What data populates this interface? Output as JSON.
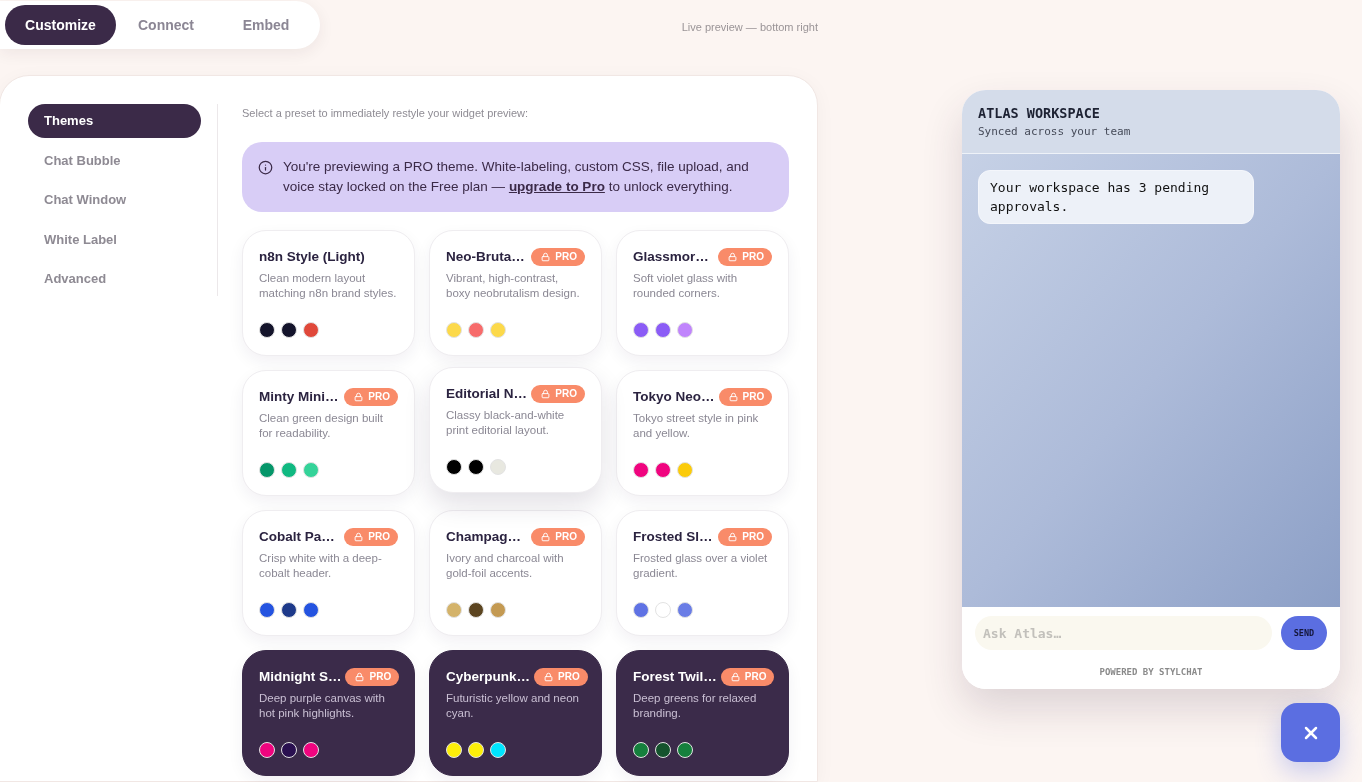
{
  "top_tabs": [
    {
      "label": "Customize",
      "selected": true
    },
    {
      "label": "Connect",
      "selected": false
    },
    {
      "label": "Embed",
      "selected": false
    }
  ],
  "preview_note": "Live preview — bottom right",
  "sidebar": {
    "items": [
      {
        "label": "Themes",
        "selected": true
      },
      {
        "label": "Chat Bubble",
        "selected": false
      },
      {
        "label": "Chat Window",
        "selected": false
      },
      {
        "label": "White Label",
        "selected": false
      },
      {
        "label": "Advanced",
        "selected": false
      }
    ]
  },
  "themes": {
    "instruction": "Select a preset to immediately restyle your widget preview:",
    "notice": {
      "text": "You're previewing a PRO theme. White-labeling, custom CSS, file upload, and voice stay locked on the Free plan — ",
      "link": "upgrade to Pro",
      "text_after": " to unlock everything."
    },
    "cards": [
      {
        "title": "n8n Style (Light)",
        "description": "Clean modern layout matching n8n brand styles.",
        "dark": false,
        "hovered": false,
        "swatches": [
          {
            "color": "#14142b"
          },
          {
            "color": "#14142b"
          },
          {
            "color": "#e0483a"
          }
        ]
      },
      {
        "title": "Neo-Bruta…",
        "badge": "PRO",
        "description": "Vibrant, high-contrast, boxy neobrutalism design.",
        "dark": false,
        "hovered": false,
        "swatches": [
          {
            "color": "#fcd94a"
          },
          {
            "color": "#f76b6b"
          },
          {
            "color": "#fcd94a"
          }
        ]
      },
      {
        "title": "Glassmor…",
        "badge": "PRO",
        "description": "Soft violet glass with rounded corners.",
        "dark": false,
        "hovered": false,
        "swatches": [
          {
            "color": "#8b5cf6"
          },
          {
            "color": "#8b5cf6"
          },
          {
            "color": "#c084fc"
          }
        ]
      },
      {
        "title": "Minty Mini…",
        "badge": "PRO",
        "description": "Clean green design built for readability.",
        "dark": false,
        "hovered": false,
        "swatches": [
          {
            "color": "#059669"
          },
          {
            "color": "#10b981"
          },
          {
            "color": "#34d399"
          }
        ]
      },
      {
        "title": "Editorial N…",
        "badge": "PRO",
        "description": "Classy black-and-white print editorial layout.",
        "dark": false,
        "hovered": true,
        "swatches": [
          {
            "color": "#000000"
          },
          {
            "color": "#000000"
          },
          {
            "color": "#e8e8e0"
          }
        ]
      },
      {
        "title": "Tokyo Neo…",
        "badge": "PRO",
        "description": "Tokyo street style in pink and yellow.",
        "dark": false,
        "hovered": false,
        "swatches": [
          {
            "color": "#f0047f"
          },
          {
            "color": "#f0047f"
          },
          {
            "color": "#fbcb0a"
          }
        ]
      },
      {
        "title": "Cobalt Pa…",
        "badge": "PRO",
        "description": "Crisp white with a deep-cobalt header.",
        "dark": false,
        "hovered": false,
        "swatches": [
          {
            "color": "#2453e0"
          },
          {
            "color": "#1e3a8a"
          },
          {
            "color": "#2453e0"
          }
        ]
      },
      {
        "title": "Champag…",
        "badge": "PRO",
        "description": "Ivory and charcoal with gold-foil accents.",
        "dark": false,
        "hovered": false,
        "swatches": [
          {
            "color": "#d4b36a"
          },
          {
            "color": "#5c4520"
          },
          {
            "color": "#c49a52"
          }
        ]
      },
      {
        "title": "Frosted Sl…",
        "badge": "PRO",
        "description": "Frosted glass over a violet gradient.",
        "dark": false,
        "hovered": false,
        "swatches": [
          {
            "color": "#5f72e4"
          },
          {
            "color": "#ffffff"
          },
          {
            "color": "#6a7de6"
          }
        ]
      },
      {
        "title": "Midnight S…",
        "badge": "PRO",
        "description": "Deep purple canvas with hot pink highlights.",
        "dark": true,
        "hovered": false,
        "swatches": [
          {
            "color": "#f0047f"
          },
          {
            "color": "#2a1050"
          },
          {
            "color": "#f0047f"
          }
        ]
      },
      {
        "title": "Cyberpunk…",
        "badge": "PRO",
        "description": "Futuristic yellow and neon cyan.",
        "dark": true,
        "hovered": false,
        "swatches": [
          {
            "color": "#fcee0a"
          },
          {
            "color": "#fcee0a"
          },
          {
            "color": "#00e5ff"
          }
        ]
      },
      {
        "title": "Forest Twil…",
        "badge": "PRO",
        "description": "Deep greens for relaxed branding.",
        "dark": true,
        "hovered": false,
        "swatches": [
          {
            "color": "#15803d"
          },
          {
            "color": "#14532d"
          },
          {
            "color": "#15803d"
          }
        ]
      }
    ]
  },
  "chat_widget": {
    "title": "ATLAS WORKSPACE",
    "subtitle": "Synced across your team",
    "messages": [
      {
        "text": "Your workspace has 3 pending approvals."
      }
    ],
    "input": {
      "placeholder": "Ask Atlas…"
    },
    "send_label": "SEND",
    "footer": "POWERED BY STYLCHAT"
  }
}
